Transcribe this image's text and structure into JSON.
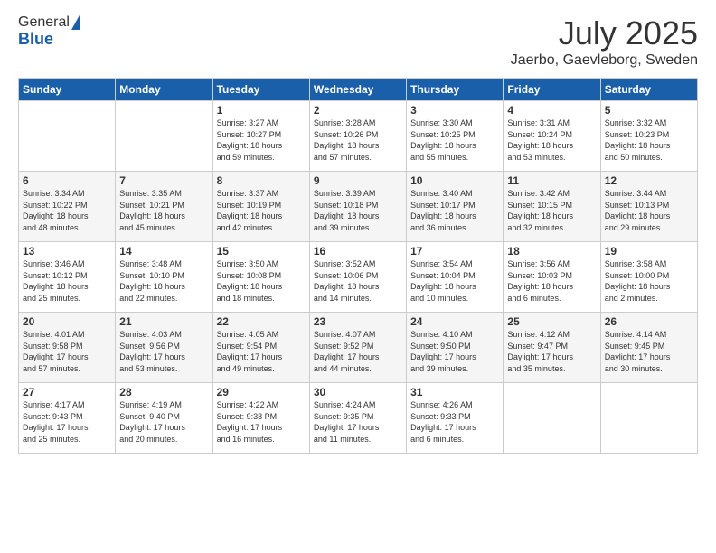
{
  "header": {
    "logo_general": "General",
    "logo_blue": "Blue",
    "main_title": "July 2025",
    "subtitle": "Jaerbo, Gaevleborg, Sweden"
  },
  "days_of_week": [
    "Sunday",
    "Monday",
    "Tuesday",
    "Wednesday",
    "Thursday",
    "Friday",
    "Saturday"
  ],
  "weeks": [
    [
      {
        "day": "",
        "info": ""
      },
      {
        "day": "",
        "info": ""
      },
      {
        "day": "1",
        "info": "Sunrise: 3:27 AM\nSunset: 10:27 PM\nDaylight: 18 hours\nand 59 minutes."
      },
      {
        "day": "2",
        "info": "Sunrise: 3:28 AM\nSunset: 10:26 PM\nDaylight: 18 hours\nand 57 minutes."
      },
      {
        "day": "3",
        "info": "Sunrise: 3:30 AM\nSunset: 10:25 PM\nDaylight: 18 hours\nand 55 minutes."
      },
      {
        "day": "4",
        "info": "Sunrise: 3:31 AM\nSunset: 10:24 PM\nDaylight: 18 hours\nand 53 minutes."
      },
      {
        "day": "5",
        "info": "Sunrise: 3:32 AM\nSunset: 10:23 PM\nDaylight: 18 hours\nand 50 minutes."
      }
    ],
    [
      {
        "day": "6",
        "info": "Sunrise: 3:34 AM\nSunset: 10:22 PM\nDaylight: 18 hours\nand 48 minutes."
      },
      {
        "day": "7",
        "info": "Sunrise: 3:35 AM\nSunset: 10:21 PM\nDaylight: 18 hours\nand 45 minutes."
      },
      {
        "day": "8",
        "info": "Sunrise: 3:37 AM\nSunset: 10:19 PM\nDaylight: 18 hours\nand 42 minutes."
      },
      {
        "day": "9",
        "info": "Sunrise: 3:39 AM\nSunset: 10:18 PM\nDaylight: 18 hours\nand 39 minutes."
      },
      {
        "day": "10",
        "info": "Sunrise: 3:40 AM\nSunset: 10:17 PM\nDaylight: 18 hours\nand 36 minutes."
      },
      {
        "day": "11",
        "info": "Sunrise: 3:42 AM\nSunset: 10:15 PM\nDaylight: 18 hours\nand 32 minutes."
      },
      {
        "day": "12",
        "info": "Sunrise: 3:44 AM\nSunset: 10:13 PM\nDaylight: 18 hours\nand 29 minutes."
      }
    ],
    [
      {
        "day": "13",
        "info": "Sunrise: 3:46 AM\nSunset: 10:12 PM\nDaylight: 18 hours\nand 25 minutes."
      },
      {
        "day": "14",
        "info": "Sunrise: 3:48 AM\nSunset: 10:10 PM\nDaylight: 18 hours\nand 22 minutes."
      },
      {
        "day": "15",
        "info": "Sunrise: 3:50 AM\nSunset: 10:08 PM\nDaylight: 18 hours\nand 18 minutes."
      },
      {
        "day": "16",
        "info": "Sunrise: 3:52 AM\nSunset: 10:06 PM\nDaylight: 18 hours\nand 14 minutes."
      },
      {
        "day": "17",
        "info": "Sunrise: 3:54 AM\nSunset: 10:04 PM\nDaylight: 18 hours\nand 10 minutes."
      },
      {
        "day": "18",
        "info": "Sunrise: 3:56 AM\nSunset: 10:03 PM\nDaylight: 18 hours\nand 6 minutes."
      },
      {
        "day": "19",
        "info": "Sunrise: 3:58 AM\nSunset: 10:00 PM\nDaylight: 18 hours\nand 2 minutes."
      }
    ],
    [
      {
        "day": "20",
        "info": "Sunrise: 4:01 AM\nSunset: 9:58 PM\nDaylight: 17 hours\nand 57 minutes."
      },
      {
        "day": "21",
        "info": "Sunrise: 4:03 AM\nSunset: 9:56 PM\nDaylight: 17 hours\nand 53 minutes."
      },
      {
        "day": "22",
        "info": "Sunrise: 4:05 AM\nSunset: 9:54 PM\nDaylight: 17 hours\nand 49 minutes."
      },
      {
        "day": "23",
        "info": "Sunrise: 4:07 AM\nSunset: 9:52 PM\nDaylight: 17 hours\nand 44 minutes."
      },
      {
        "day": "24",
        "info": "Sunrise: 4:10 AM\nSunset: 9:50 PM\nDaylight: 17 hours\nand 39 minutes."
      },
      {
        "day": "25",
        "info": "Sunrise: 4:12 AM\nSunset: 9:47 PM\nDaylight: 17 hours\nand 35 minutes."
      },
      {
        "day": "26",
        "info": "Sunrise: 4:14 AM\nSunset: 9:45 PM\nDaylight: 17 hours\nand 30 minutes."
      }
    ],
    [
      {
        "day": "27",
        "info": "Sunrise: 4:17 AM\nSunset: 9:43 PM\nDaylight: 17 hours\nand 25 minutes."
      },
      {
        "day": "28",
        "info": "Sunrise: 4:19 AM\nSunset: 9:40 PM\nDaylight: 17 hours\nand 20 minutes."
      },
      {
        "day": "29",
        "info": "Sunrise: 4:22 AM\nSunset: 9:38 PM\nDaylight: 17 hours\nand 16 minutes."
      },
      {
        "day": "30",
        "info": "Sunrise: 4:24 AM\nSunset: 9:35 PM\nDaylight: 17 hours\nand 11 minutes."
      },
      {
        "day": "31",
        "info": "Sunrise: 4:26 AM\nSunset: 9:33 PM\nDaylight: 17 hours\nand 6 minutes."
      },
      {
        "day": "",
        "info": ""
      },
      {
        "day": "",
        "info": ""
      }
    ]
  ]
}
